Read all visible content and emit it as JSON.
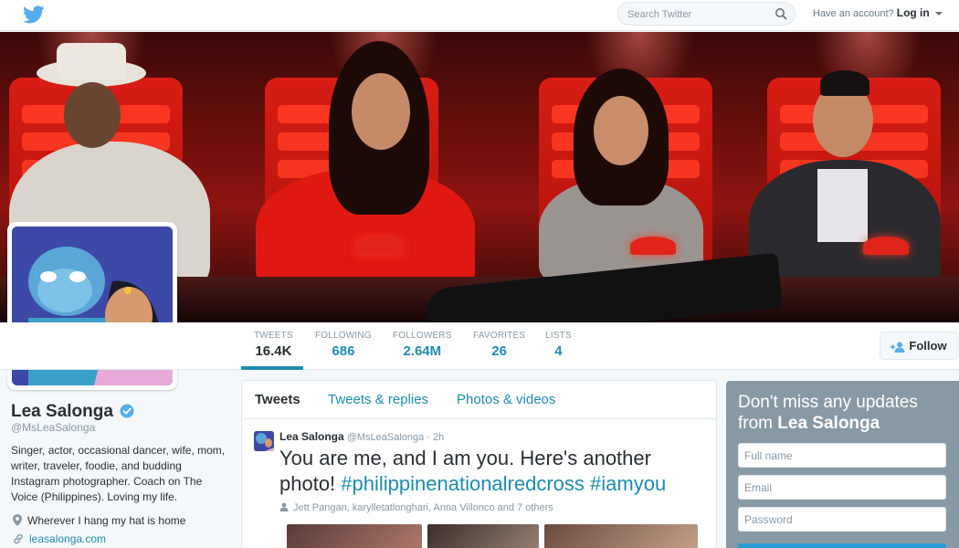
{
  "topbar": {
    "search_placeholder": "Search Twitter",
    "have_account": "Have an account?",
    "login": "Log in"
  },
  "profile": {
    "name": "Lea Salonga",
    "handle": "@MsLeaSalonga",
    "bio": "Singer, actor, occasional dancer, wife, mom, writer, traveler, foodie, and budding Instagram photographer. Coach on The Voice (Philippines). Loving my life.",
    "location": "Wherever I hang my hat is home",
    "website": "leasalonga.com"
  },
  "stats": [
    {
      "label": "TWEETS",
      "value": "16.4K"
    },
    {
      "label": "FOLLOWING",
      "value": "686"
    },
    {
      "label": "FOLLOWERS",
      "value": "2.64M"
    },
    {
      "label": "FAVORITES",
      "value": "26"
    },
    {
      "label": "LISTS",
      "value": "4"
    }
  ],
  "follow_label": "Follow",
  "timeline": {
    "tabs": [
      "Tweets",
      "Tweets & replies",
      "Photos & videos"
    ]
  },
  "tweet": {
    "name": "Lea Salonga",
    "meta": "@MsLeaSalonga · 2h",
    "text_plain": "You are me, and I am you. Here's another photo!",
    "hashtag1": "#philippinenationalredcross",
    "hashtag2": "#iamyou",
    "tagged": "Jett Pangan, karylletatlonghari, Anna Villonco and 7 others"
  },
  "signup": {
    "headline_prefix": "Don't miss any updates from",
    "headline_name": "Lea Salonga",
    "fullname_placeholder": "Full name",
    "email_placeholder": "Email",
    "password_placeholder": "Password"
  },
  "colors": {
    "link": "#1f8cad",
    "banner_red": "#b0120c",
    "signup_bg": "#8899a6"
  },
  "icons": [
    "twitter-bird-icon",
    "search-icon",
    "verified-icon",
    "location-pin-icon",
    "link-icon",
    "person-icon",
    "follow-person-plus-icon"
  ]
}
